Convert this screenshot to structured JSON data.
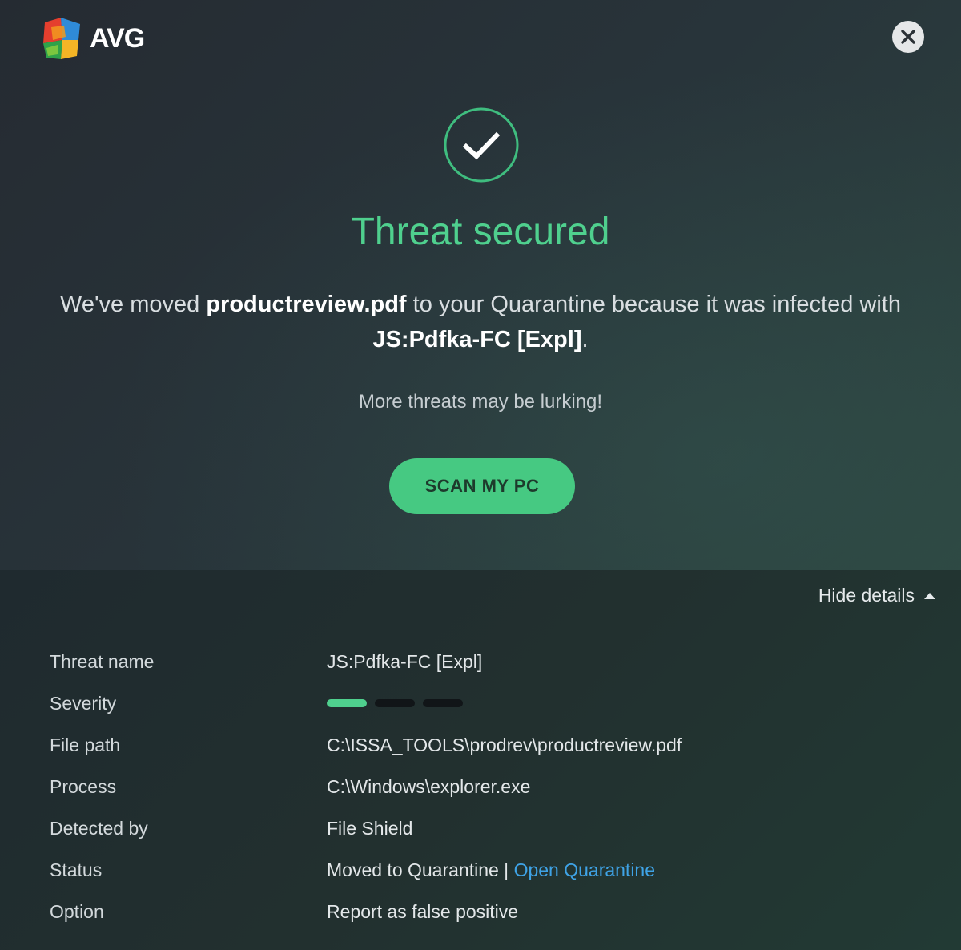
{
  "app": {
    "logo_text": "AVG"
  },
  "dialog": {
    "title": "Threat secured",
    "message_prefix": "We've moved ",
    "file_name": "productreview.pdf",
    "message_middle": " to your Quarantine because it was infected with ",
    "threat_name": "JS:Pdfka-FC [Expl]",
    "message_suffix": ".",
    "lurking_text": "More threats may be lurking!",
    "scan_button_label": "SCAN MY PC",
    "hide_details_label": "Hide details"
  },
  "details": {
    "threat_name_label": "Threat name",
    "threat_name_value": "JS:Pdfka-FC [Expl]",
    "severity_label": "Severity",
    "severity_level": 1,
    "severity_max": 3,
    "file_path_label": "File path",
    "file_path_value": "C:\\ISSA_TOOLS\\prodrev\\productreview.pdf",
    "process_label": "Process",
    "process_value": "C:\\Windows\\explorer.exe",
    "detected_by_label": "Detected by",
    "detected_by_value": "File Shield",
    "status_label": "Status",
    "status_value": "Moved to Quarantine",
    "status_separator": " | ",
    "open_quarantine_link": "Open Quarantine",
    "option_label": "Option",
    "report_false_positive_link": "Report as false positive"
  },
  "colors": {
    "accent_green": "#4fd08e",
    "button_green": "#46c982",
    "link_blue": "#3fa3e6"
  },
  "icons": {
    "logo": "avg-logo-icon",
    "close": "close-icon",
    "check": "check-circle-icon",
    "hide_details": "triangle-up-icon"
  }
}
